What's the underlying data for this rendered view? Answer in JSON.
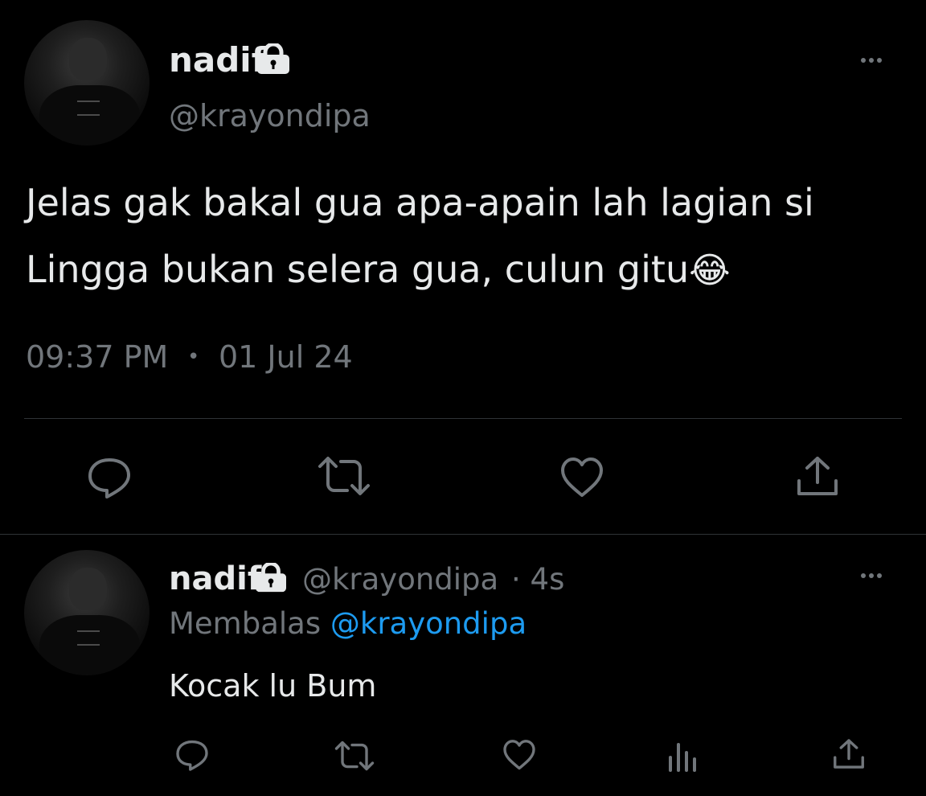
{
  "colors": {
    "background": "#000000",
    "text": "#e7e9ea",
    "muted": "#71767b",
    "accent": "#1d9bf0",
    "divider": "#2f3336"
  },
  "main_tweet": {
    "display_name": "nadif",
    "handle": "@krayondipa",
    "text_line1": "Jelas gak bakal gua apa-apain lah lagian si",
    "text_line2": "Lingga bukan selera gua, culun gitu",
    "emoji": "😂",
    "time": "09:37 PM",
    "separator": "•",
    "date": "01 Jul 24",
    "icons": [
      "lock-icon",
      "more-icon",
      "reply-icon",
      "retweet-icon",
      "like-icon",
      "share-icon"
    ]
  },
  "reply_tweet": {
    "display_name": "nadif",
    "handle": "@krayondipa",
    "age": "· 4s",
    "replying_prefix": "Membalas",
    "replying_to": "@krayondipa",
    "text": "Kocak lu Bum",
    "icons": [
      "lock-icon",
      "more-icon",
      "reply-icon",
      "retweet-icon",
      "like-icon",
      "views-icon",
      "share-icon"
    ]
  }
}
